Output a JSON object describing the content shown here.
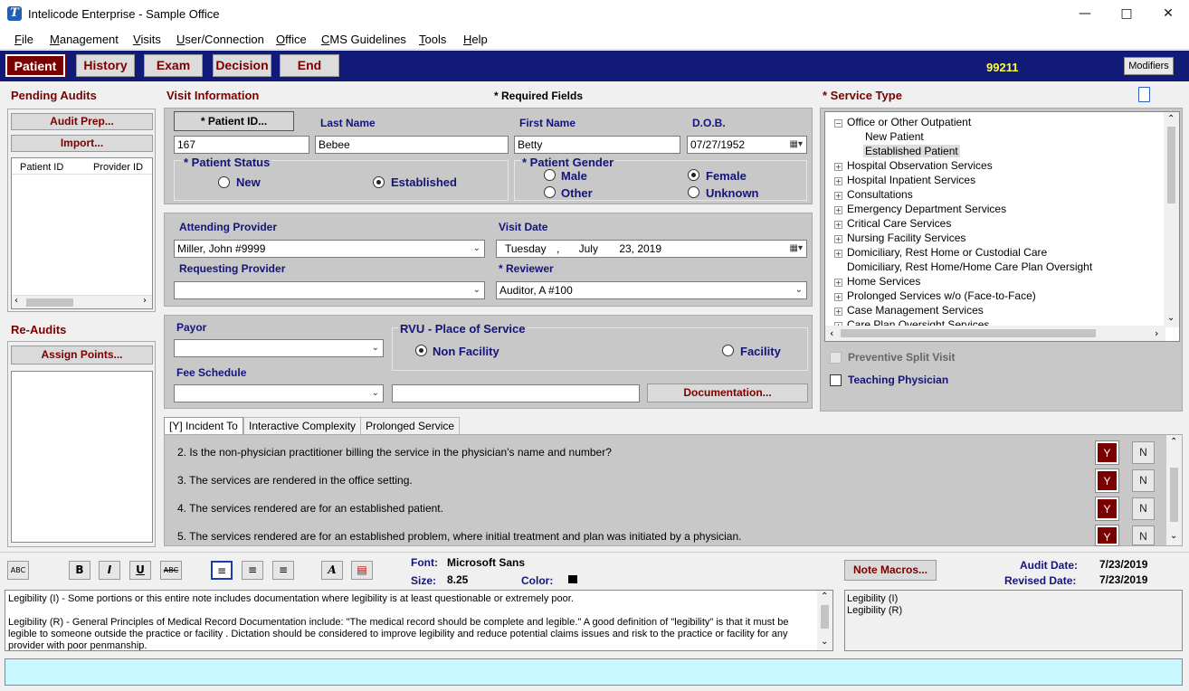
{
  "window": {
    "title": "Intelicode Enterprise - Sample Office",
    "icon": "app-logo-icon"
  },
  "menu": [
    "File",
    "Management",
    "Visits",
    "User/Connection",
    "Office",
    "CMS Guidelines",
    "Tools",
    "Help"
  ],
  "nav": {
    "tabs": [
      "Patient",
      "History",
      "Exam",
      "Decision",
      "End"
    ],
    "code": "99211",
    "modifiers": "Modifiers"
  },
  "pending": {
    "title": "Pending Audits",
    "audit_prep": "Audit Prep...",
    "import": "Import...",
    "col_patient": "Patient ID",
    "col_provider": "Provider ID"
  },
  "reaudits": {
    "title": "Re-Audits",
    "assign": "Assign Points..."
  },
  "visit": {
    "title": "Visit Information",
    "required": "* Required Fields",
    "patient_id_btn": "* Patient ID...",
    "last_name_lbl": "Last Name",
    "first_name_lbl": "First Name",
    "dob_lbl": "D.O.B.",
    "patient_id": "167",
    "last_name": "Bebee",
    "first_name": "Betty",
    "dob": "07/27/1952",
    "status_lbl": "* Patient Status",
    "status_new": "New",
    "status_est": "Established",
    "gender_lbl": "* Patient Gender",
    "male": "Male",
    "female": "Female",
    "other": "Other",
    "unknown": "Unknown",
    "attending_lbl": "Attending Provider",
    "attending": "Miller, John #9999",
    "visit_date_lbl": "Visit Date",
    "visit_day": "Tuesday",
    "visit_sep": ",",
    "visit_month": "July",
    "visit_rest": "23, 2019",
    "requesting_lbl": "Requesting Provider",
    "requesting": "",
    "reviewer_lbl": "* Reviewer",
    "reviewer": "Auditor, A #100",
    "payor_lbl": "Payor",
    "rvu_lbl": "RVU - Place of Service",
    "non_facility": "Non Facility",
    "facility": "Facility",
    "fee_lbl": "Fee Schedule",
    "documentation": "Documentation..."
  },
  "service": {
    "title": "* Service Type",
    "tree": [
      "Office or Other Outpatient",
      "New Patient",
      "Established Patient",
      "Hospital Observation Services",
      "Hospital Inpatient Services",
      "Consultations",
      "Emergency Department Services",
      "Critical Care Services",
      "Nursing Facility Services",
      "Domiciliary, Rest Home or Custodial Care",
      "Domiciliary, Rest Home/Home Care Plan Oversight",
      "Home Services",
      "Prolonged Services w/o (Face-to-Face)",
      "Case Management Services",
      "Care Plan Oversight Services"
    ],
    "preventive": "Preventive Split Visit",
    "teaching": "Teaching Physician"
  },
  "incident": {
    "tabs": [
      "[Y] Incident To",
      "Interactive Complexity",
      "Prolonged Service"
    ],
    "questions": [
      "2. Is the non-physician practitioner billing the service in the physician's name and number?",
      "3. The services are rendered in the office setting.",
      "4. The services rendered are for an established patient.",
      "5. The services rendered are for an established problem, where initial treatment and plan was initiated by a physician."
    ],
    "y": "Y",
    "n": "N"
  },
  "toolbar": {
    "font_lbl": "Font:",
    "font": "Microsoft Sans",
    "size_lbl": "Size:",
    "size": "8.25",
    "color_lbl": "Color:",
    "macros": "Note Macros...",
    "audit_date_lbl": "Audit Date:",
    "audit_date": "7/23/2019",
    "revised_lbl": "Revised Date:",
    "revised_date": "7/23/2019",
    "spell": "ABC",
    "b": "B",
    "i": "I",
    "u": "U",
    "strike": "ABC",
    "font_a": "A"
  },
  "notes": {
    "p1": "Legibility (I) - Some portions or this entire note includes documentation where legibility is at least questionable or extremely poor.",
    "p2": "Legibility (R) - General Principles of Medical Record Documentation include: \"The medical record should be complete and legible.\"  A good definition of \"legibility\" is that it must be legible to someone outside the practice or facility .  Dictation should be considered to improve legibility and reduce potential claims issues and risk to the practice or facility for any provider with poor penmanship.",
    "macros_list": [
      "Legibility (I)",
      "Legibility (R)"
    ]
  }
}
